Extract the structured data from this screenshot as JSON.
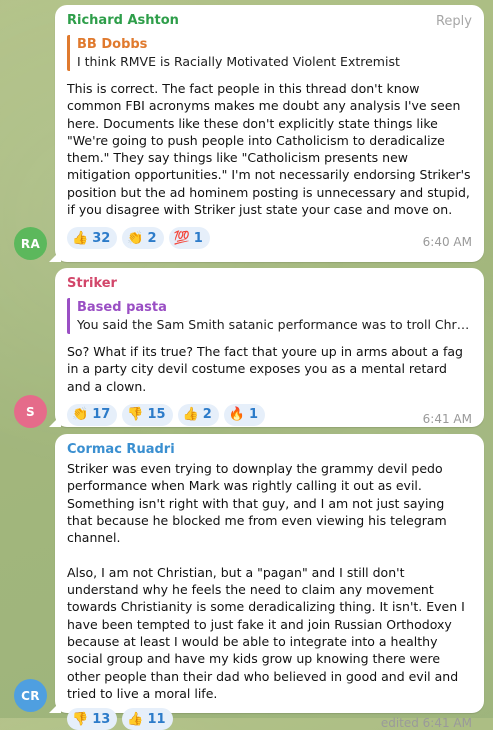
{
  "messages": [
    {
      "sender": "Richard Ashton",
      "sender_color": "#2e9e4a",
      "avatar_initials": "RA",
      "avatar_color": "#5cb85c",
      "reply_label": "Reply",
      "quote": {
        "author": "BB Dobbs",
        "author_color": "#e07a2e",
        "text": "I think RMVE is Racially Motivated Violent Extremist"
      },
      "text": "This is correct. The fact people in this thread don't know common FBI acronyms makes me doubt any analysis I've seen here. Documents like these don't explicitly state things like \"We're going to push people into Catholicism to deradicalize them.\" They say things like \"Catholicism presents new mitigation opportunities.\" I'm not necessarily endorsing Striker's position but the ad hominem posting is unnecessary and stupid, if you disagree with Striker just state your case and move on.",
      "reactions": [
        {
          "emoji": "👍",
          "icon": "thumbs-up-emoji",
          "count": "32"
        },
        {
          "emoji": "👏",
          "icon": "clapping-hands-emoji",
          "count": "2"
        },
        {
          "emoji": "💯",
          "icon": "hundred-points-emoji",
          "count": "1"
        }
      ],
      "time": "6:40 AM"
    },
    {
      "sender": "Striker",
      "sender_color": "#d2466a",
      "avatar_initials": "S",
      "avatar_color": "#e56b8a",
      "quote": {
        "author": "Based pasta",
        "author_color": "#9a4fc4",
        "text": "You said the Sam Smith satanic performance was to troll Christians"
      },
      "text": "So? What if its true? The fact that youre up in arms about a fag in a party city devil costume exposes you as a mental retard and a clown.",
      "reactions": [
        {
          "emoji": "👏",
          "icon": "clapping-hands-emoji",
          "count": "17"
        },
        {
          "emoji": "👎",
          "icon": "thumbs-down-emoji",
          "count": "15"
        },
        {
          "emoji": "👍",
          "icon": "thumbs-up-emoji",
          "count": "2"
        },
        {
          "emoji": "🔥",
          "icon": "fire-emoji",
          "count": "1"
        }
      ],
      "time": "6:41 AM"
    },
    {
      "sender": "Cormac Ruadri",
      "sender_color": "#3a8fd0",
      "avatar_initials": "CR",
      "avatar_color": "#4f9fe0",
      "text": "Striker was even trying to downplay the grammy devil pedo performance when Mark was rightly calling it out as evil. Something isn't right with that guy, and I am not just saying that because he blocked me from even viewing his telegram channel.\n\n Also, I am not Christian, but a \"pagan\" and I still don't understand why he feels the need to claim any movement towards Christianity is some deradicalizing thing. It isn't. Even I have been tempted to just fake it and join Russian Orthodoxy because at least I would be able to integrate into a healthy social group and have my kids grow up knowing there were other people than their dad who believed in good and evil and tried to live a moral life.",
      "reactions": [
        {
          "emoji": "👎",
          "icon": "thumbs-down-emoji",
          "count": "13"
        },
        {
          "emoji": "👍",
          "icon": "thumbs-up-emoji",
          "count": "11"
        }
      ],
      "time": "edited 6:41 AM"
    }
  ]
}
